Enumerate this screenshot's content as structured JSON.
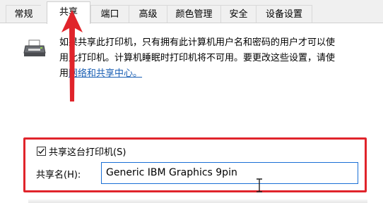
{
  "tabs": [
    {
      "label": "常规",
      "active": false
    },
    {
      "label": "共享",
      "active": true
    },
    {
      "label": "端口",
      "active": false
    },
    {
      "label": "高级",
      "active": false
    },
    {
      "label": "颜色管理",
      "active": false
    },
    {
      "label": "安全",
      "active": false
    },
    {
      "label": "设备设置",
      "active": false
    }
  ],
  "share_panel": {
    "description_line1": "如果共享此打印机，只有拥有此计算机用户名和密码的用户才可以使",
    "description_line2": "用此打印机。计算机睡眠时打印机将不可用。要更改这些设置，请使",
    "description_line3_prefix": "用",
    "network_link": "网络和共享中心。",
    "share_checkbox_label": "共享这台打印机(S)",
    "share_checkbox_checked": true,
    "share_name_label": "共享名(H):",
    "share_name_value": "Generic IBM Graphics 9pin"
  },
  "annotation": {
    "color": "#e0242b",
    "icon": "red-arrow-pointing-up"
  },
  "icons": {
    "printer": "printer-icon",
    "cursor": "text-cursor-icon"
  }
}
